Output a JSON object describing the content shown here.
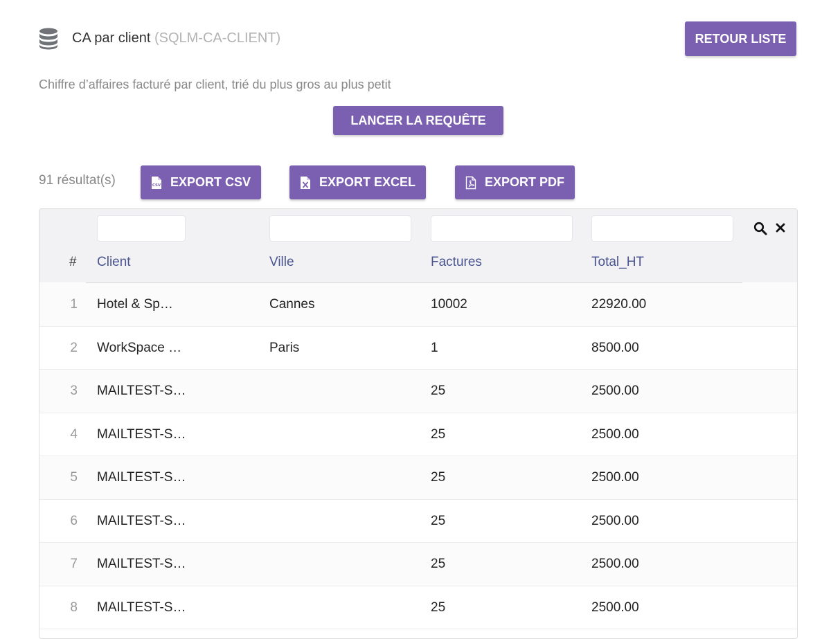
{
  "header": {
    "title": "CA par client",
    "code": "(SQLM-CA-CLIENT)",
    "back_label": "RETOUR LISTE"
  },
  "description": "Chiffre d’affaires facturé par client, trié du plus gros au plus petit",
  "run_label": "LANCER LA REQUÊTE",
  "results_count": "91 résultat(s)",
  "exports": {
    "csv": "EXPORT CSV",
    "excel": "EXPORT EXCEL",
    "pdf": "EXPORT PDF"
  },
  "icons": {
    "title": "database-icon",
    "csv": "csv-file-icon",
    "excel": "excel-file-icon",
    "pdf": "pdf-file-icon",
    "search": "search-icon",
    "clear": "close-icon"
  },
  "colors": {
    "accent": "#7b5fb0",
    "header_text": "#4a5590"
  },
  "table": {
    "columns": [
      "#",
      "Client",
      "Ville",
      "Factures",
      "Total_HT"
    ],
    "rows": [
      [
        "1",
        "Hotel & Sp…",
        "Cannes",
        "10002",
        "22920.00"
      ],
      [
        "2",
        "WorkSpace …",
        "Paris",
        "1",
        "8500.00"
      ],
      [
        "3",
        "MAILTEST-S…",
        "",
        "25",
        "2500.00"
      ],
      [
        "4",
        "MAILTEST-S…",
        "",
        "25",
        "2500.00"
      ],
      [
        "5",
        "MAILTEST-S…",
        "",
        "25",
        "2500.00"
      ],
      [
        "6",
        "MAILTEST-S…",
        "",
        "25",
        "2500.00"
      ],
      [
        "7",
        "MAILTEST-S…",
        "",
        "25",
        "2500.00"
      ],
      [
        "8",
        "MAILTEST-S…",
        "",
        "25",
        "2500.00"
      ]
    ]
  }
}
